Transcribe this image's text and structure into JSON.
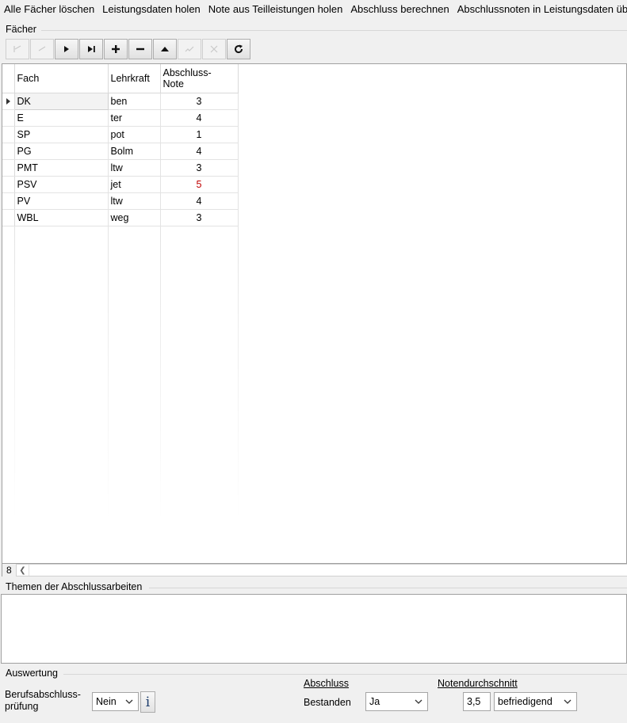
{
  "menu": {
    "items": [
      "Alle Fächer löschen",
      "Leistungsdaten holen",
      "Note aus Teilleistungen holen",
      "Abschluss berechnen",
      "Abschlussnoten in Leistungsdaten übert"
    ]
  },
  "faecher": {
    "group_label": "Fächer",
    "navigator": [
      {
        "icon": "first-record-icon",
        "enabled": false
      },
      {
        "icon": "prior-record-icon",
        "enabled": false
      },
      {
        "icon": "next-record-icon",
        "enabled": true
      },
      {
        "icon": "last-record-icon",
        "enabled": true
      },
      {
        "icon": "insert-record-icon",
        "enabled": true
      },
      {
        "icon": "delete-record-icon",
        "enabled": true
      },
      {
        "icon": "edit-record-icon",
        "enabled": true
      },
      {
        "icon": "post-record-icon",
        "enabled": false
      },
      {
        "icon": "cancel-record-icon",
        "enabled": false
      },
      {
        "icon": "refresh-icon",
        "enabled": true
      }
    ],
    "columns": {
      "fach": "Fach",
      "lehrkraft": "Lehrkraft",
      "note_line1": "Abschluss-",
      "note_line2": "Note"
    },
    "rows": [
      {
        "fach": "DK",
        "lehrkraft": "ben",
        "note": "3"
      },
      {
        "fach": "E",
        "lehrkraft": "ter",
        "note": "4"
      },
      {
        "fach": "SP",
        "lehrkraft": "pot",
        "note": "1"
      },
      {
        "fach": "PG",
        "lehrkraft": "Bolm",
        "note": "4"
      },
      {
        "fach": "PMT",
        "lehrkraft": "ltw",
        "note": "3"
      },
      {
        "fach": "PSV",
        "lehrkraft": "jet",
        "note": "5"
      },
      {
        "fach": "PV",
        "lehrkraft": "ltw",
        "note": "4"
      },
      {
        "fach": "WBL",
        "lehrkraft": "weg",
        "note": "3"
      }
    ],
    "record_count": "8",
    "colors": {
      "failing_grade": "#c00000"
    }
  },
  "themen": {
    "group_label": "Themen der Abschlussarbeiten"
  },
  "auswertung": {
    "group_label": "Auswertung",
    "berufsabschluss_label_line1": "Berufsabschluss-",
    "berufsabschluss_label_line2": "prüfung",
    "berufsabschluss_value": "Nein",
    "info_button_label": "i",
    "abschluss_heading": "Abschluss",
    "bestanden_label": "Bestanden",
    "bestanden_value": "Ja",
    "notendurchschnitt_heading": "Notendurchschnitt",
    "notendurchschnitt_value": "3,5",
    "notendurchschnitt_text": "befriedigend"
  }
}
